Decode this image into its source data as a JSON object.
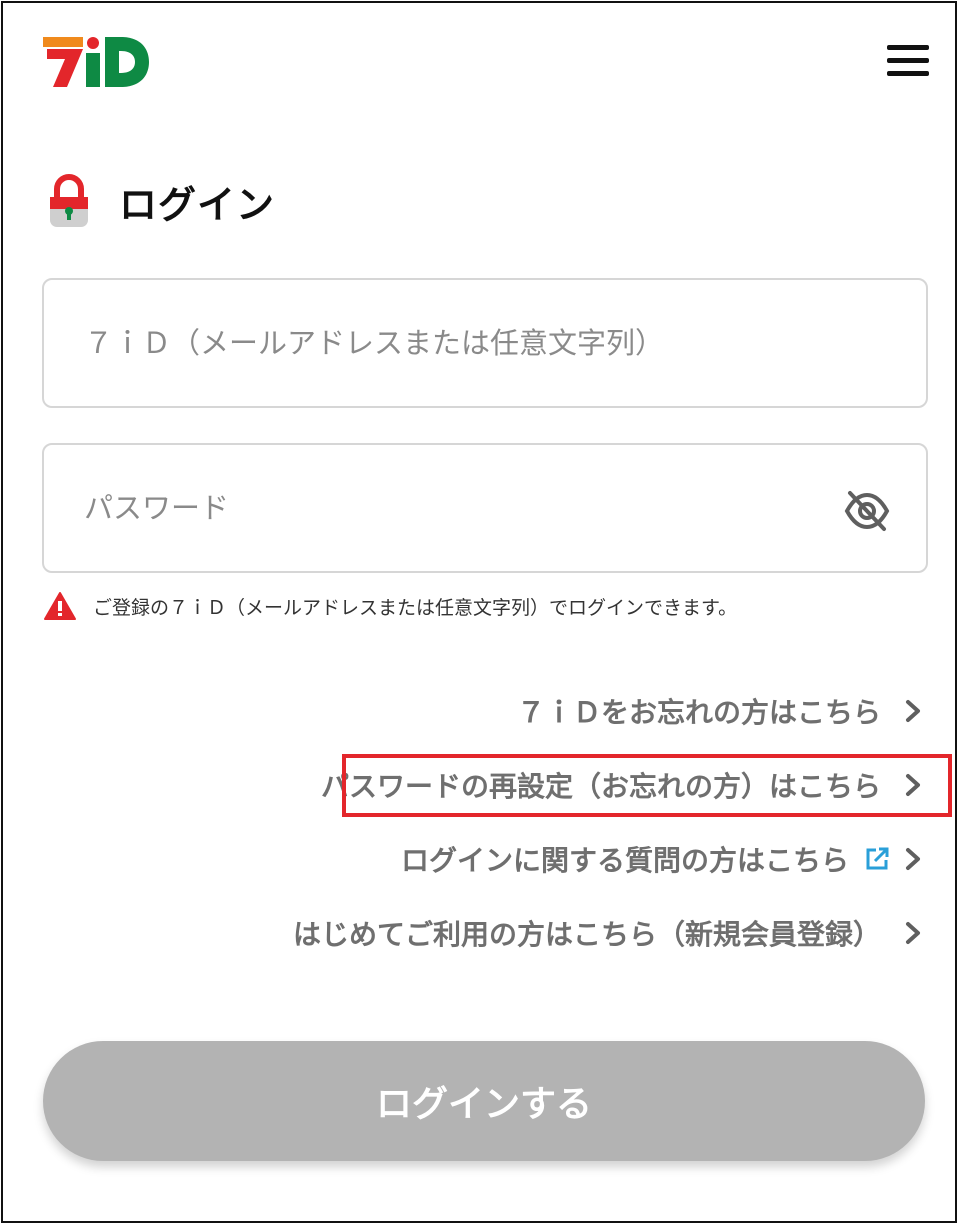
{
  "logo": {
    "icon": "7id-logo-icon",
    "colors": {
      "seven_orange": "#f08a1d",
      "seven_red": "#e3262b",
      "i_green": "#0e8a44"
    }
  },
  "header": {
    "menu_icon": "hamburger-menu-icon"
  },
  "login": {
    "title": "ログイン",
    "lock_icon": "lock-icon",
    "id_field": {
      "placeholder": "７ｉＤ（メールアドレスまたは任意文字列）",
      "value": ""
    },
    "password_field": {
      "placeholder": "パスワード",
      "value": "",
      "toggle_icon": "eye-slash-icon"
    },
    "notice": {
      "icon": "warning-icon",
      "text": "ご登録の７ｉＤ（メールアドレスまたは任意文字列）でログインできます。",
      "color": "#e3262b"
    },
    "links": [
      {
        "label": "７ｉＤをお忘れの方はこちら"
      },
      {
        "label": "パスワードの再設定（お忘れの方）はこちら",
        "highlighted": true
      },
      {
        "label": "ログインに関する質問の方はこちら",
        "external": true,
        "external_icon": "external-link-icon"
      },
      {
        "label": "はじめてご利用の方はこちら（新規会員登録）"
      }
    ],
    "submit_label": "ログインする",
    "submit_color": "#b3b3b3",
    "highlight_color": "#e3262b"
  }
}
